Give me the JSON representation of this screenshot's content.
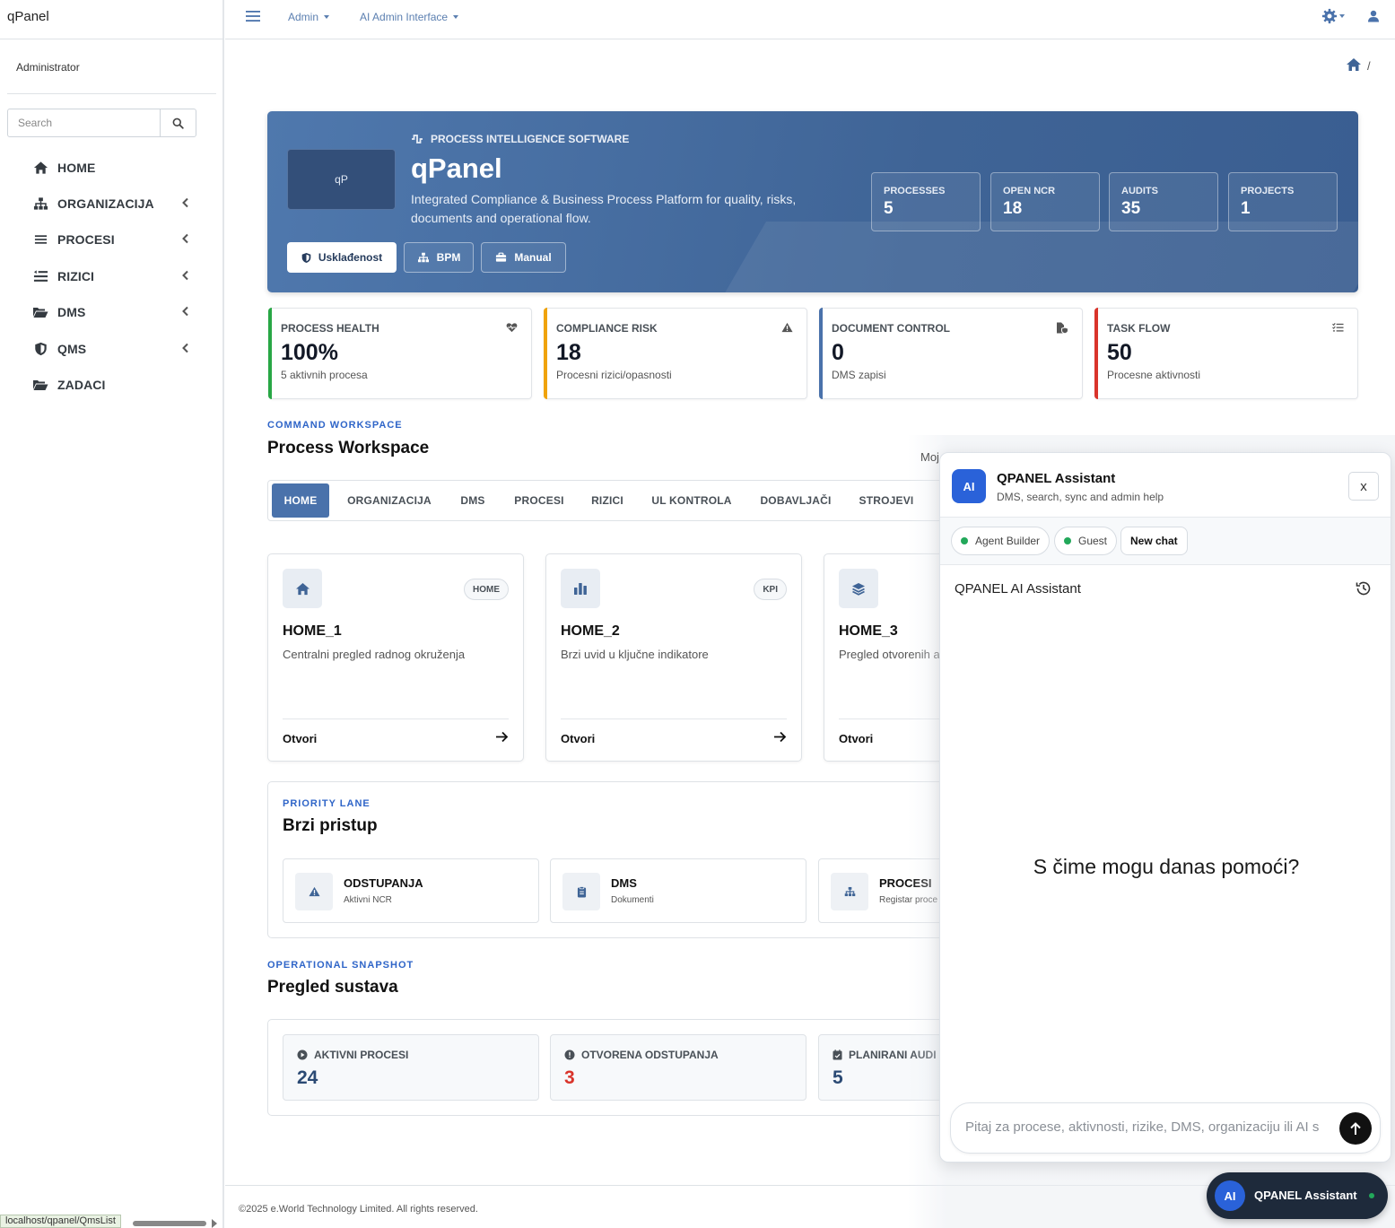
{
  "app": {
    "brand": "qPanel",
    "user": "Administrator"
  },
  "sidebar": {
    "search_placeholder": "Search",
    "items": [
      {
        "label": "HOME",
        "icon": "home-icon"
      },
      {
        "label": "ORGANIZACIJA",
        "icon": "sitemap-icon"
      },
      {
        "label": "PROCESI",
        "icon": "list-icon"
      },
      {
        "label": "RIZICI",
        "icon": "risk-list-icon"
      },
      {
        "label": "DMS",
        "icon": "folder-open-icon"
      },
      {
        "label": "QMS",
        "icon": "shield-icon"
      },
      {
        "label": "ZADACI",
        "icon": "folder-open-icon"
      }
    ]
  },
  "topbar": {
    "menu1": "Admin",
    "menu2": "AI Admin Interface",
    "breadcrumb_sep": "/"
  },
  "hero": {
    "tag": "PROCESS INTELLIGENCE SOFTWARE",
    "title": "qPanel",
    "logo_text": "qP",
    "description": "Integrated Compliance & Business Process Platform for quality, risks, documents and operational flow.",
    "buttons": [
      "Usklađenost",
      "BPM",
      "Manual"
    ],
    "stats": [
      {
        "label": "PROCESSES",
        "value": "5"
      },
      {
        "label": "OPEN NCR",
        "value": "18"
      },
      {
        "label": "AUDITS",
        "value": "35"
      },
      {
        "label": "PROJECTS",
        "value": "1"
      }
    ]
  },
  "kpis": [
    {
      "label": "PROCESS HEALTH",
      "value": "100%",
      "sub": "5 aktivnih procesa",
      "color": "#28a745"
    },
    {
      "label": "COMPLIANCE RISK",
      "value": "18",
      "sub": "Procesni rizici/opasnosti",
      "color": "#f0a30a"
    },
    {
      "label": "DOCUMENT CONTROL",
      "value": "0",
      "sub": "DMS zapisi",
      "color": "#4a72ab"
    },
    {
      "label": "TASK FLOW",
      "value": "50",
      "sub": "Procesne aktivnosti",
      "color": "#d9342b"
    }
  ],
  "workspace": {
    "eyebrow": "COMMAND WORKSPACE",
    "title": "Process Workspace",
    "tabs": [
      "HOME",
      "ORGANIZACIJA",
      "DMS",
      "PROCESI",
      "RIZICI",
      "UL KONTROLA",
      "DOBAVLJAČI",
      "STROJEVI"
    ],
    "cards": [
      {
        "badge": "HOME",
        "title": "HOME_1",
        "desc": "Centralni pregled radnog okruženja",
        "open": "Otvori"
      },
      {
        "badge": "KPI",
        "title": "HOME_2",
        "desc": "Brzi uvid u ključne indikatore",
        "open": "Otvori"
      },
      {
        "badge": "",
        "title": "HOME_3",
        "desc": "Pregled otvorenih a",
        "open": "Otvori"
      }
    ]
  },
  "priority": {
    "eyebrow": "PRIORITY LANE",
    "title": "Brzi pristup",
    "items": [
      {
        "title": "ODSTUPANJA",
        "sub": "Aktivni NCR"
      },
      {
        "title": "DMS",
        "sub": "Dokumenti"
      },
      {
        "title": "PROCESI",
        "sub": "Registar proce"
      }
    ]
  },
  "snapshot": {
    "eyebrow": "OPERATIONAL SNAPSHOT",
    "title": "Pregled sustava",
    "items": [
      {
        "label": "AKTIVNI PROCESI",
        "value": "24",
        "color": "#2b4a74"
      },
      {
        "label": "OTVORENA ODSTUPANJA",
        "value": "3",
        "color": "#d9342b"
      },
      {
        "label": "PLANIRANI AUDI",
        "value": "5",
        "color": "#2b4a74"
      }
    ]
  },
  "overlay_text": "Moj",
  "chat": {
    "badge": "AI",
    "title": "QPANEL Assistant",
    "subtitle": "DMS, search, sync and admin help",
    "close": "x",
    "pills": [
      "Agent Builder",
      "Guest"
    ],
    "new_chat": "New chat",
    "name": "QPANEL AI Assistant",
    "welcome": "S čime mogu danas pomoći?",
    "input_placeholder": "Pitaj za procese, aktivnosti, rizike, DMS, organizaciju ili AI s"
  },
  "launcher": {
    "badge": "AI",
    "label": "QPANEL Assistant"
  },
  "footer": "©2025 e.World Technology Limited. All rights reserved.",
  "status_url": "localhost/qpanel/QmsList"
}
